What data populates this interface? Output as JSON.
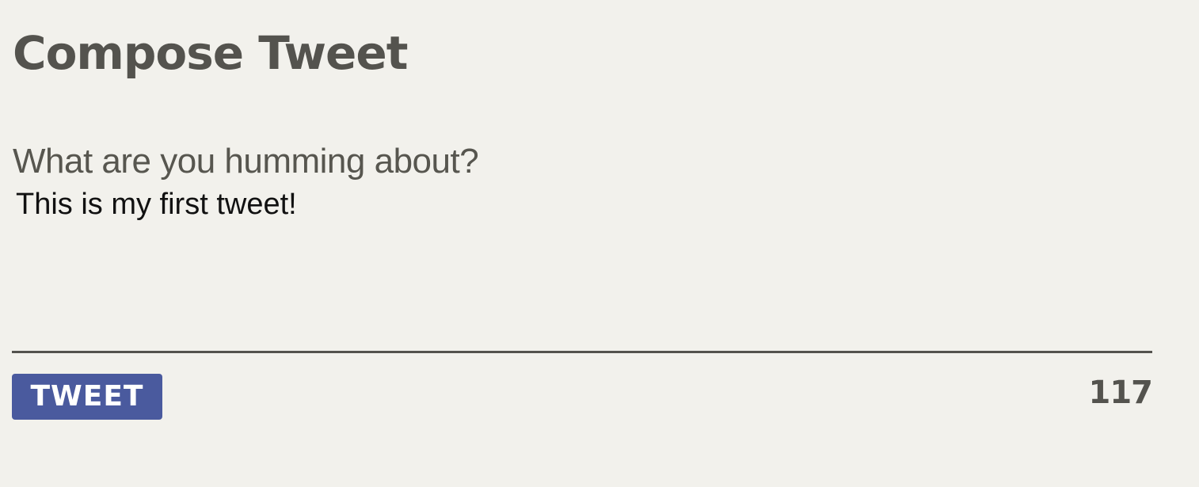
{
  "compose": {
    "title": "Compose Tweet",
    "prompt_label": "What are you humming about?",
    "tweet_text": "This is my first tweet!",
    "button_label": "TWEET",
    "characters_remaining": "117"
  },
  "colors": {
    "background": "#f2f1ec",
    "text_primary": "#54534e",
    "button_background": "#4a5a9e",
    "button_text": "#ffffff"
  }
}
